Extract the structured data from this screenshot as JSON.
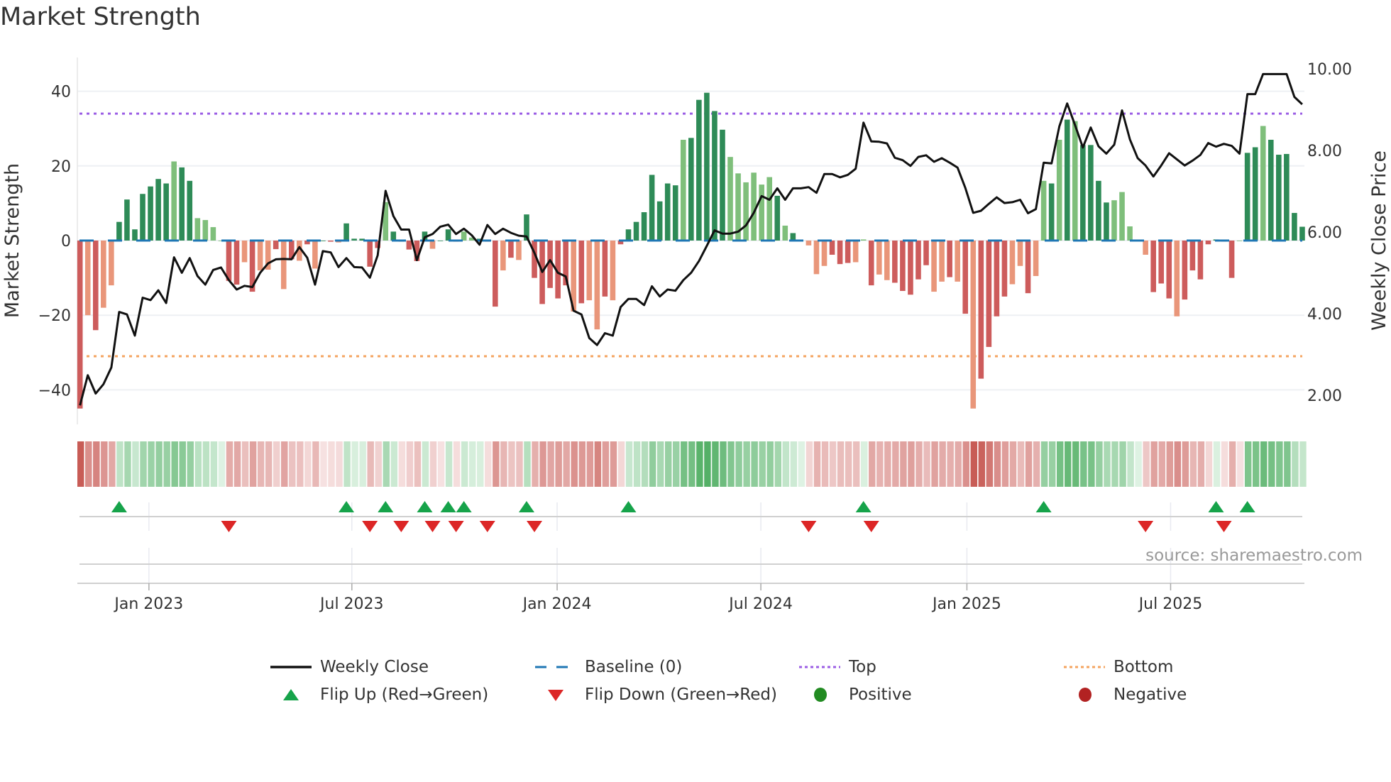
{
  "title": "Market Strength",
  "source": "source: sharemaestro.com",
  "legend": {
    "weekly_close": "Weekly Close",
    "baseline": "Baseline (0)",
    "top": "Top",
    "bottom": "Bottom",
    "flip_up": "Flip Up (Red→Green)",
    "flip_down": "Flip Down (Green→Red)",
    "positive": "Positive",
    "negative": "Negative"
  },
  "colors": {
    "pos_dark": "#2e8b57",
    "pos_light": "#7fbf7b",
    "neg_dark": "#cd5c5c",
    "neg_light": "#e9967a",
    "baseline": "#1f77b4",
    "top": "#9b5de5",
    "bottom": "#f4a460",
    "flip_up": "#16a34a",
    "flip_down": "#dc2626",
    "positive": "#228b22",
    "negative": "#b22222"
  },
  "chart_data": {
    "type": "bar+line",
    "title": "Market Strength",
    "ylabel": "Market Strength",
    "y2label": "Weekly Close Price",
    "ylim": [
      -50,
      50
    ],
    "y2lim": [
      1.4,
      10.9
    ],
    "yticks": [
      "40",
      "20",
      "0",
      "−20",
      "−40"
    ],
    "ytick_values": [
      40,
      20,
      0,
      -20,
      -40
    ],
    "y2ticks": [
      "10.00",
      "8.00",
      "6.00",
      "4.00",
      "2.00"
    ],
    "y2tick_values": [
      10,
      8,
      6,
      4,
      2
    ],
    "xticks": [
      {
        "label": "Jan 2023",
        "week": 8.8
      },
      {
        "label": "Jul 2023",
        "week": 34.7
      },
      {
        "label": "Jan 2024",
        "week": 60.9
      },
      {
        "label": "Jul 2024",
        "week": 86.9
      },
      {
        "label": "Jan 2025",
        "week": 113.2
      },
      {
        "label": "Jul 2025",
        "week": 139.2
      }
    ],
    "top": 34,
    "bottom": -31,
    "baseline": 0,
    "strength": [
      -45,
      -20,
      -24,
      -18,
      -12,
      5,
      11,
      3,
      12.5,
      14.5,
      16.5,
      15.3,
      21.2,
      19.6,
      16,
      6,
      5.5,
      3.6,
      0,
      -10.8,
      -11.8,
      -5.8,
      -13.7,
      -8,
      -7.8,
      -2.3,
      -13,
      -5,
      -5.4,
      -1,
      -7.5,
      0,
      -0.3,
      -0.5,
      4.6,
      0.5,
      0.5,
      -7,
      -2,
      10.3,
      2.4,
      -0.3,
      -2.4,
      -5.5,
      2.4,
      -2.2,
      0,
      3,
      -0.3,
      2.4,
      0.8,
      0.5,
      -0.3,
      -17.7,
      -8,
      -4.6,
      -5.2,
      7,
      -10,
      -17,
      -12.7,
      -15.5,
      -12,
      -19,
      -16.8,
      -16,
      -23.8,
      -15,
      -16,
      -1,
      3,
      5,
      7.6,
      17.6,
      10.5,
      15.3,
      14.8,
      27,
      27.5,
      37.7,
      39.6,
      34.7,
      29.7,
      22.4,
      18,
      15.6,
      18.2,
      15,
      17,
      12,
      4,
      2,
      0,
      -1.3,
      -9,
      -6.8,
      -3.8,
      -6.3,
      -6,
      -5.8,
      0.3,
      -12,
      -9.1,
      -10.6,
      -11.3,
      -13.5,
      -14.5,
      -10.4,
      -6.6,
      -13.7,
      -11,
      -9.8,
      -11,
      -19.6,
      -45,
      -37,
      -28.5,
      -20.3,
      -15,
      -11.7,
      -6.8,
      -14.1,
      -9.5,
      16,
      15.3,
      27,
      32.4,
      32,
      25.6,
      25.6,
      16,
      10.2,
      10.8,
      13,
      3.8,
      0,
      -3.8,
      -13.8,
      -11.5,
      -15.5,
      -20.3,
      -15.8,
      -8,
      -10.4,
      -1,
      0.3,
      -0.3,
      -10,
      0,
      23.5,
      25,
      30.7,
      27,
      23,
      23.2,
      7.4,
      3.7
    ],
    "shade": "dldlldddddddlddllllddldlldldldlddldddddldddddldddlldddldlddddddldlldlddddddddldddddlllllldldlllldddlldlldddddlldldlddddlldlldldlddddllllldddldddddldlddldddddllddll",
    "close": [
      1.96,
      2.7,
      2.25,
      2.48,
      2.89,
      4.25,
      4.19,
      3.67,
      4.6,
      4.54,
      4.78,
      4.47,
      5.59,
      5.21,
      5.57,
      5.13,
      4.92,
      5.28,
      5.34,
      5.03,
      4.8,
      4.89,
      4.86,
      5.21,
      5.44,
      5.54,
      5.55,
      5.54,
      5.84,
      5.58,
      4.92,
      5.74,
      5.71,
      5.35,
      5.57,
      5.35,
      5.34,
      5.09,
      5.64,
      7.22,
      6.6,
      6.27,
      6.27,
      5.52,
      6.08,
      6.16,
      6.34,
      6.39,
      6.16,
      6.29,
      6.13,
      5.9,
      6.38,
      6.16,
      6.29,
      6.19,
      6.12,
      6.1,
      5.7,
      5.23,
      5.52,
      5.21,
      5.12,
      4.28,
      4.19,
      3.61,
      3.44,
      3.73,
      3.67,
      4.37,
      4.57,
      4.57,
      4.42,
      4.88,
      4.63,
      4.8,
      4.77,
      5.03,
      5.21,
      5.5,
      5.87,
      6.25,
      6.17,
      6.17,
      6.22,
      6.37,
      6.68,
      7.09,
      7.0,
      7.28,
      7.0,
      7.28,
      7.28,
      7.31,
      7.17,
      7.63,
      7.63,
      7.55,
      7.61,
      7.76,
      8.89,
      8.43,
      8.42,
      8.38,
      8.03,
      7.97,
      7.83,
      8.05,
      8.09,
      7.93,
      8.02,
      7.91,
      7.79,
      7.29,
      6.68,
      6.73,
      6.9,
      7.06,
      6.92,
      6.94,
      7.0,
      6.67,
      6.77,
      7.91,
      7.89,
      8.8,
      9.36,
      8.83,
      8.28,
      8.77,
      8.31,
      8.13,
      8.35,
      9.19,
      8.48,
      8.02,
      7.84,
      7.57,
      7.84,
      8.14,
      7.99,
      7.84,
      7.96,
      8.1,
      8.39,
      8.3,
      8.37,
      8.32,
      8.13,
      9.59,
      9.59,
      10.08,
      10.08,
      10.08,
      10.08,
      9.52,
      9.34
    ],
    "flip_up_weeks": [
      5,
      34,
      39,
      44,
      47,
      49,
      57,
      70,
      100,
      123,
      145,
      149
    ],
    "flip_down_weeks": [
      19,
      37,
      41,
      45,
      48,
      52,
      58,
      93,
      101,
      136,
      146
    ]
  }
}
